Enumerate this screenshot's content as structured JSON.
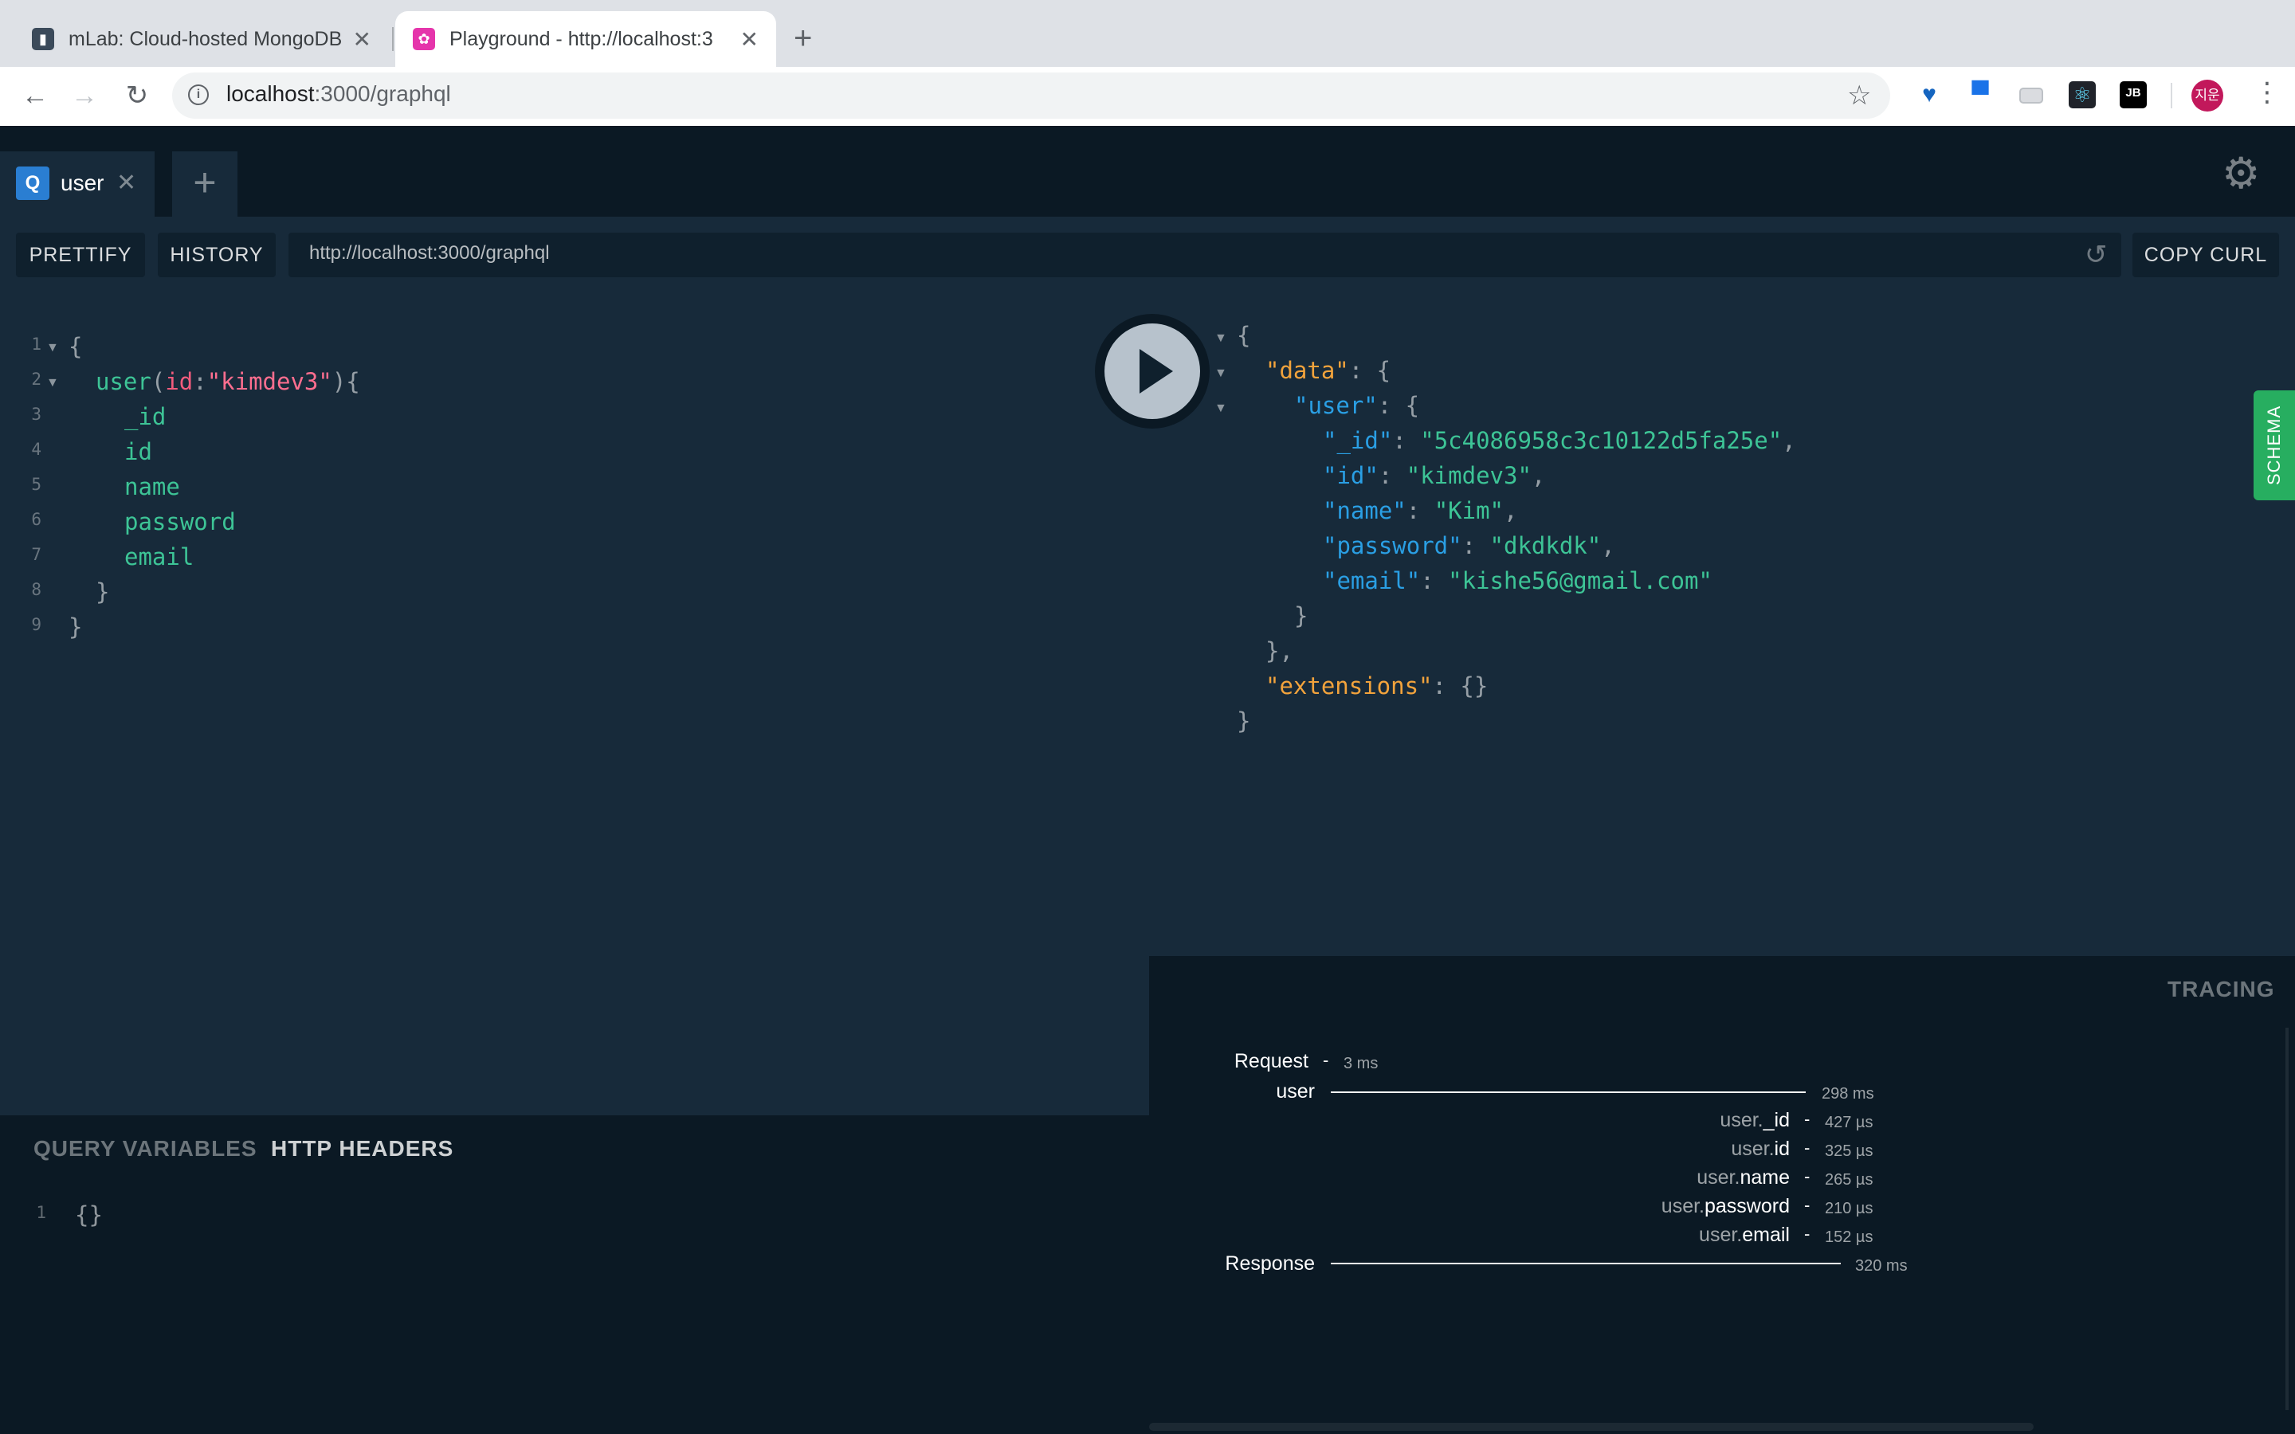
{
  "browser": {
    "tabs": [
      {
        "title": "mLab: Cloud-hosted MongoDB",
        "icon": "mlab-favicon",
        "active": false
      },
      {
        "title": "Playground - http://localhost:3",
        "icon": "graphql-favicon",
        "active": true
      }
    ],
    "close_glyph": "✕",
    "new_tab_glyph": "+",
    "url_host": "localhost",
    "url_path": ":3000/graphql",
    "info_glyph": "i",
    "avatar_text": "지운",
    "colors": {
      "tabstrip": "#dee1e6",
      "toolbar": "#ffffff",
      "omnibox": "#f1f3f4"
    }
  },
  "playground": {
    "tab_badge": "Q",
    "tab_label": "user",
    "tab_close": "✕",
    "add_tab": "+",
    "prettify_label": "PRETTIFY",
    "history_label": "HISTORY",
    "endpoint": "http://localhost:3000/graphql",
    "copy_curl_label": "COPY CURL",
    "schema_label": "SCHEMA",
    "colors": {
      "background": "#172a3a",
      "dark": "#0b1924",
      "accent_green": "#27ae60",
      "field": "#3dc496",
      "arg": "#f25c7d",
      "key": "#2a9fe4",
      "key_top": "#f2a33c"
    }
  },
  "editor": {
    "lines": [
      "1",
      "2",
      "3",
      "4",
      "5",
      "6",
      "7",
      "8",
      "9"
    ],
    "open_brace": "{",
    "query_name": "user",
    "arg_open": "(",
    "arg_name": "id",
    "arg_colon": ":",
    "arg_value": "\"kimdev3\"",
    "arg_close": "){",
    "fields": [
      "_id",
      "id",
      "name",
      "password",
      "email"
    ],
    "inner_close": "}",
    "outer_close": "}"
  },
  "variables": {
    "tab_query_vars": "QUERY VARIABLES",
    "tab_http_headers": "HTTP HEADERS",
    "line": "1",
    "content": "{}"
  },
  "result": {
    "open": "{",
    "data_key": "\"data\"",
    "user_key": "\"user\"",
    "colon_brace": ": {",
    "fields": [
      {
        "key": "\"_id\"",
        "value": "\"5c4086958c3c10122d5fa25e\"",
        "trail": ","
      },
      {
        "key": "\"id\"",
        "value": "\"kimdev3\"",
        "trail": ","
      },
      {
        "key": "\"name\"",
        "value": "\"Kim\"",
        "trail": ","
      },
      {
        "key": "\"password\"",
        "value": "\"dkdkdk\"",
        "trail": ","
      },
      {
        "key": "\"email\"",
        "value": "\"kishe56@gmail.com\"",
        "trail": ""
      }
    ],
    "close_user": "}",
    "close_data": "},",
    "extensions_key": "\"extensions\"",
    "extensions_value": ": {}",
    "close": "}"
  },
  "tracing": {
    "title": "TRACING",
    "request_label": "Request",
    "request_time": "3 ms",
    "user_label": "user",
    "user_time": "298 ms",
    "fields": [
      {
        "prefix": "user.",
        "name": "_id",
        "time": "427 µs"
      },
      {
        "prefix": "user.",
        "name": "id",
        "time": "325 µs"
      },
      {
        "prefix": "user.",
        "name": "name",
        "time": "265 µs"
      },
      {
        "prefix": "user.",
        "name": "password",
        "time": "210 µs"
      },
      {
        "prefix": "user.",
        "name": "email",
        "time": "152 µs"
      }
    ],
    "response_label": "Response",
    "response_time": "320 ms",
    "dash": "-"
  }
}
